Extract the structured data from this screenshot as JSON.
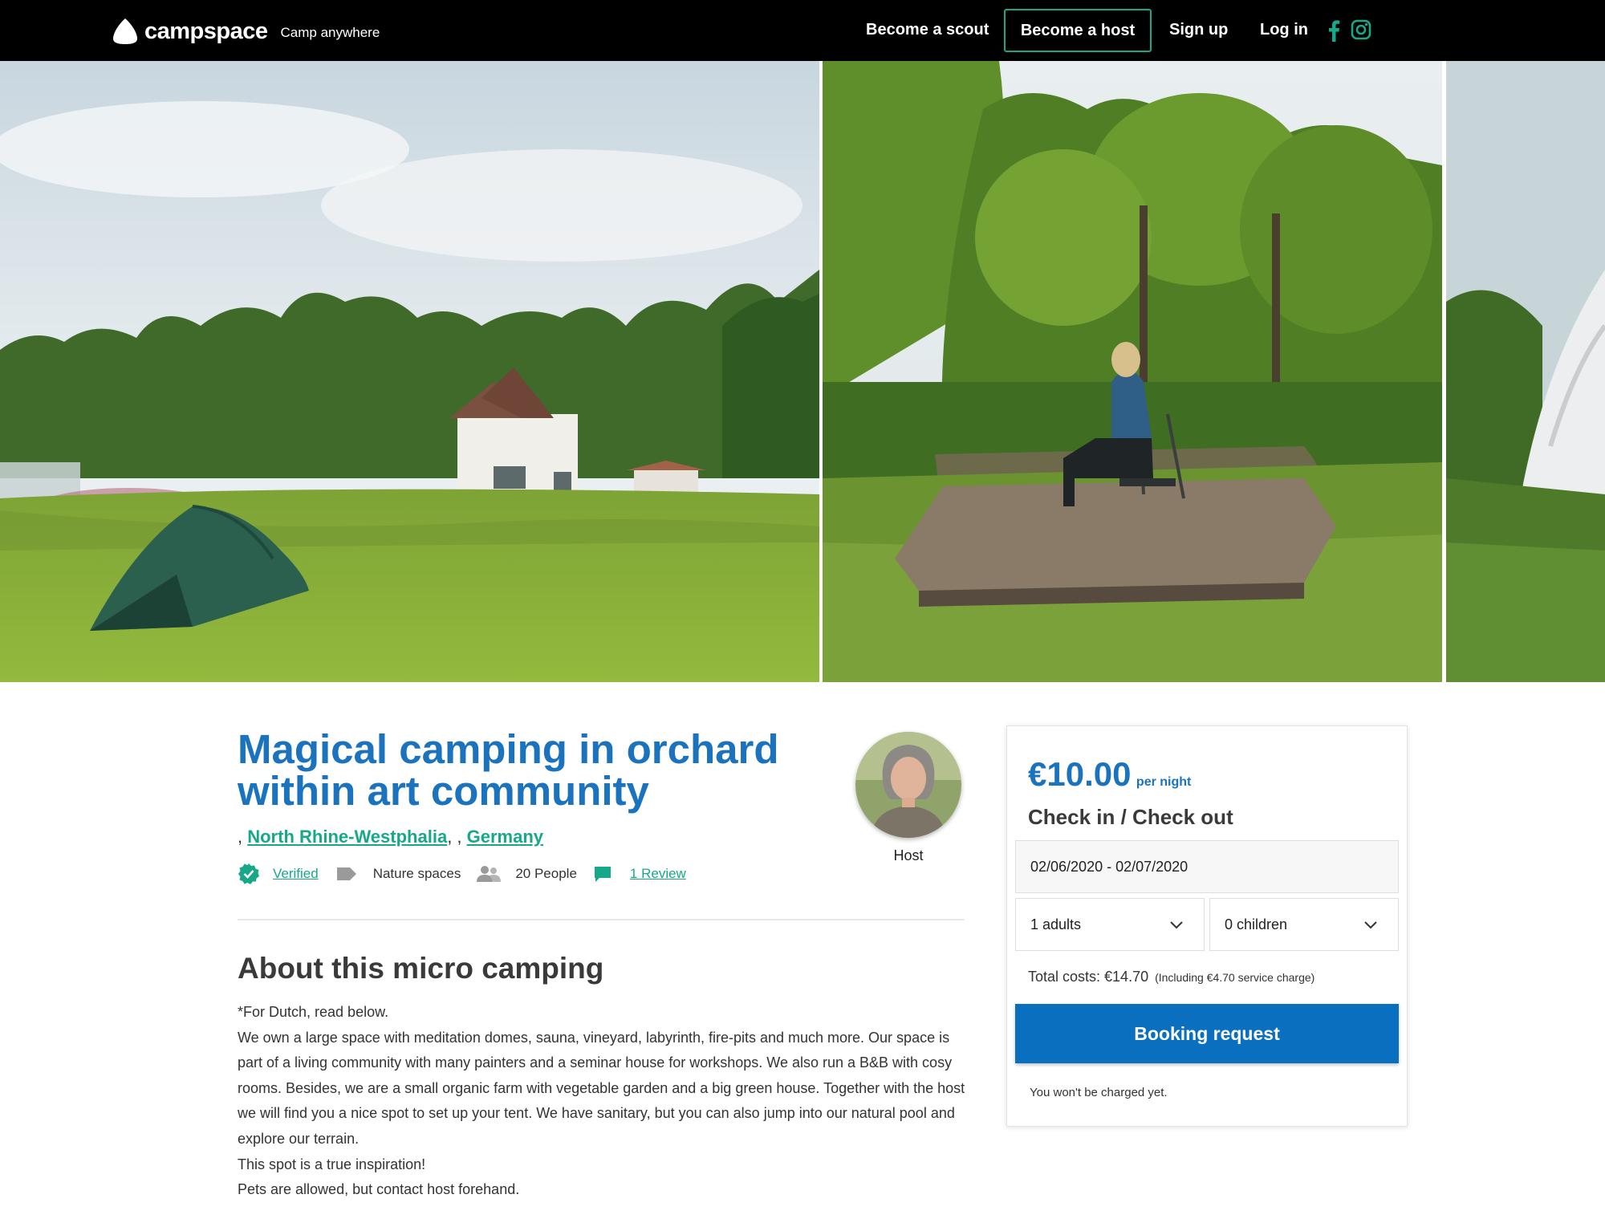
{
  "header": {
    "brand": "campspace",
    "tagline": "Camp anywhere",
    "nav": {
      "scout": "Become a scout",
      "host": "Become a host",
      "signup": "Sign up",
      "login": "Log in"
    },
    "social_icons": [
      "facebook-icon",
      "instagram-icon"
    ],
    "accent_color": "#17a889"
  },
  "listing": {
    "title": "Magical camping in orchard within art community",
    "location_prefix": ", ",
    "region": "North Rhine-Westphalia",
    "location_sep": ", , ",
    "country": "Germany",
    "meta": {
      "verified": "Verified",
      "category": "Nature spaces",
      "capacity": "20 People",
      "reviews": "1 Review"
    },
    "host_label": "Host",
    "title_color": "#1a73bc"
  },
  "about": {
    "heading": "About this micro camping",
    "paragraphs": [
      "*For Dutch, read below.",
      "We own a large space with meditation domes, sauna, vineyard, labyrinth, fire-pits and much more. Our space is part of a living community with many painters and a seminar house for workshops. We also run a B&B with cosy rooms. Besides, we are a small organic farm with vegetable garden and a big green house. Together with the host we will find you a nice spot to set up your tent. We have sanitary, but you can also jump into our natural pool and explore our terrain.",
      "This spot is a true inspiration!",
      "Pets are allowed, but contact host forehand."
    ]
  },
  "booking": {
    "price": "€10.00",
    "price_unit": "per night",
    "checkin_label": "Check in / Check out",
    "dates": "02/06/2020 - 02/07/2020",
    "adults": "1 adults",
    "children": "0 children",
    "total": "Total costs: €14.70",
    "total_note": "(Including €4.70 service charge)",
    "button": "Booking request",
    "note": "You won't be charged yet.",
    "button_color": "#0b6fc0"
  }
}
